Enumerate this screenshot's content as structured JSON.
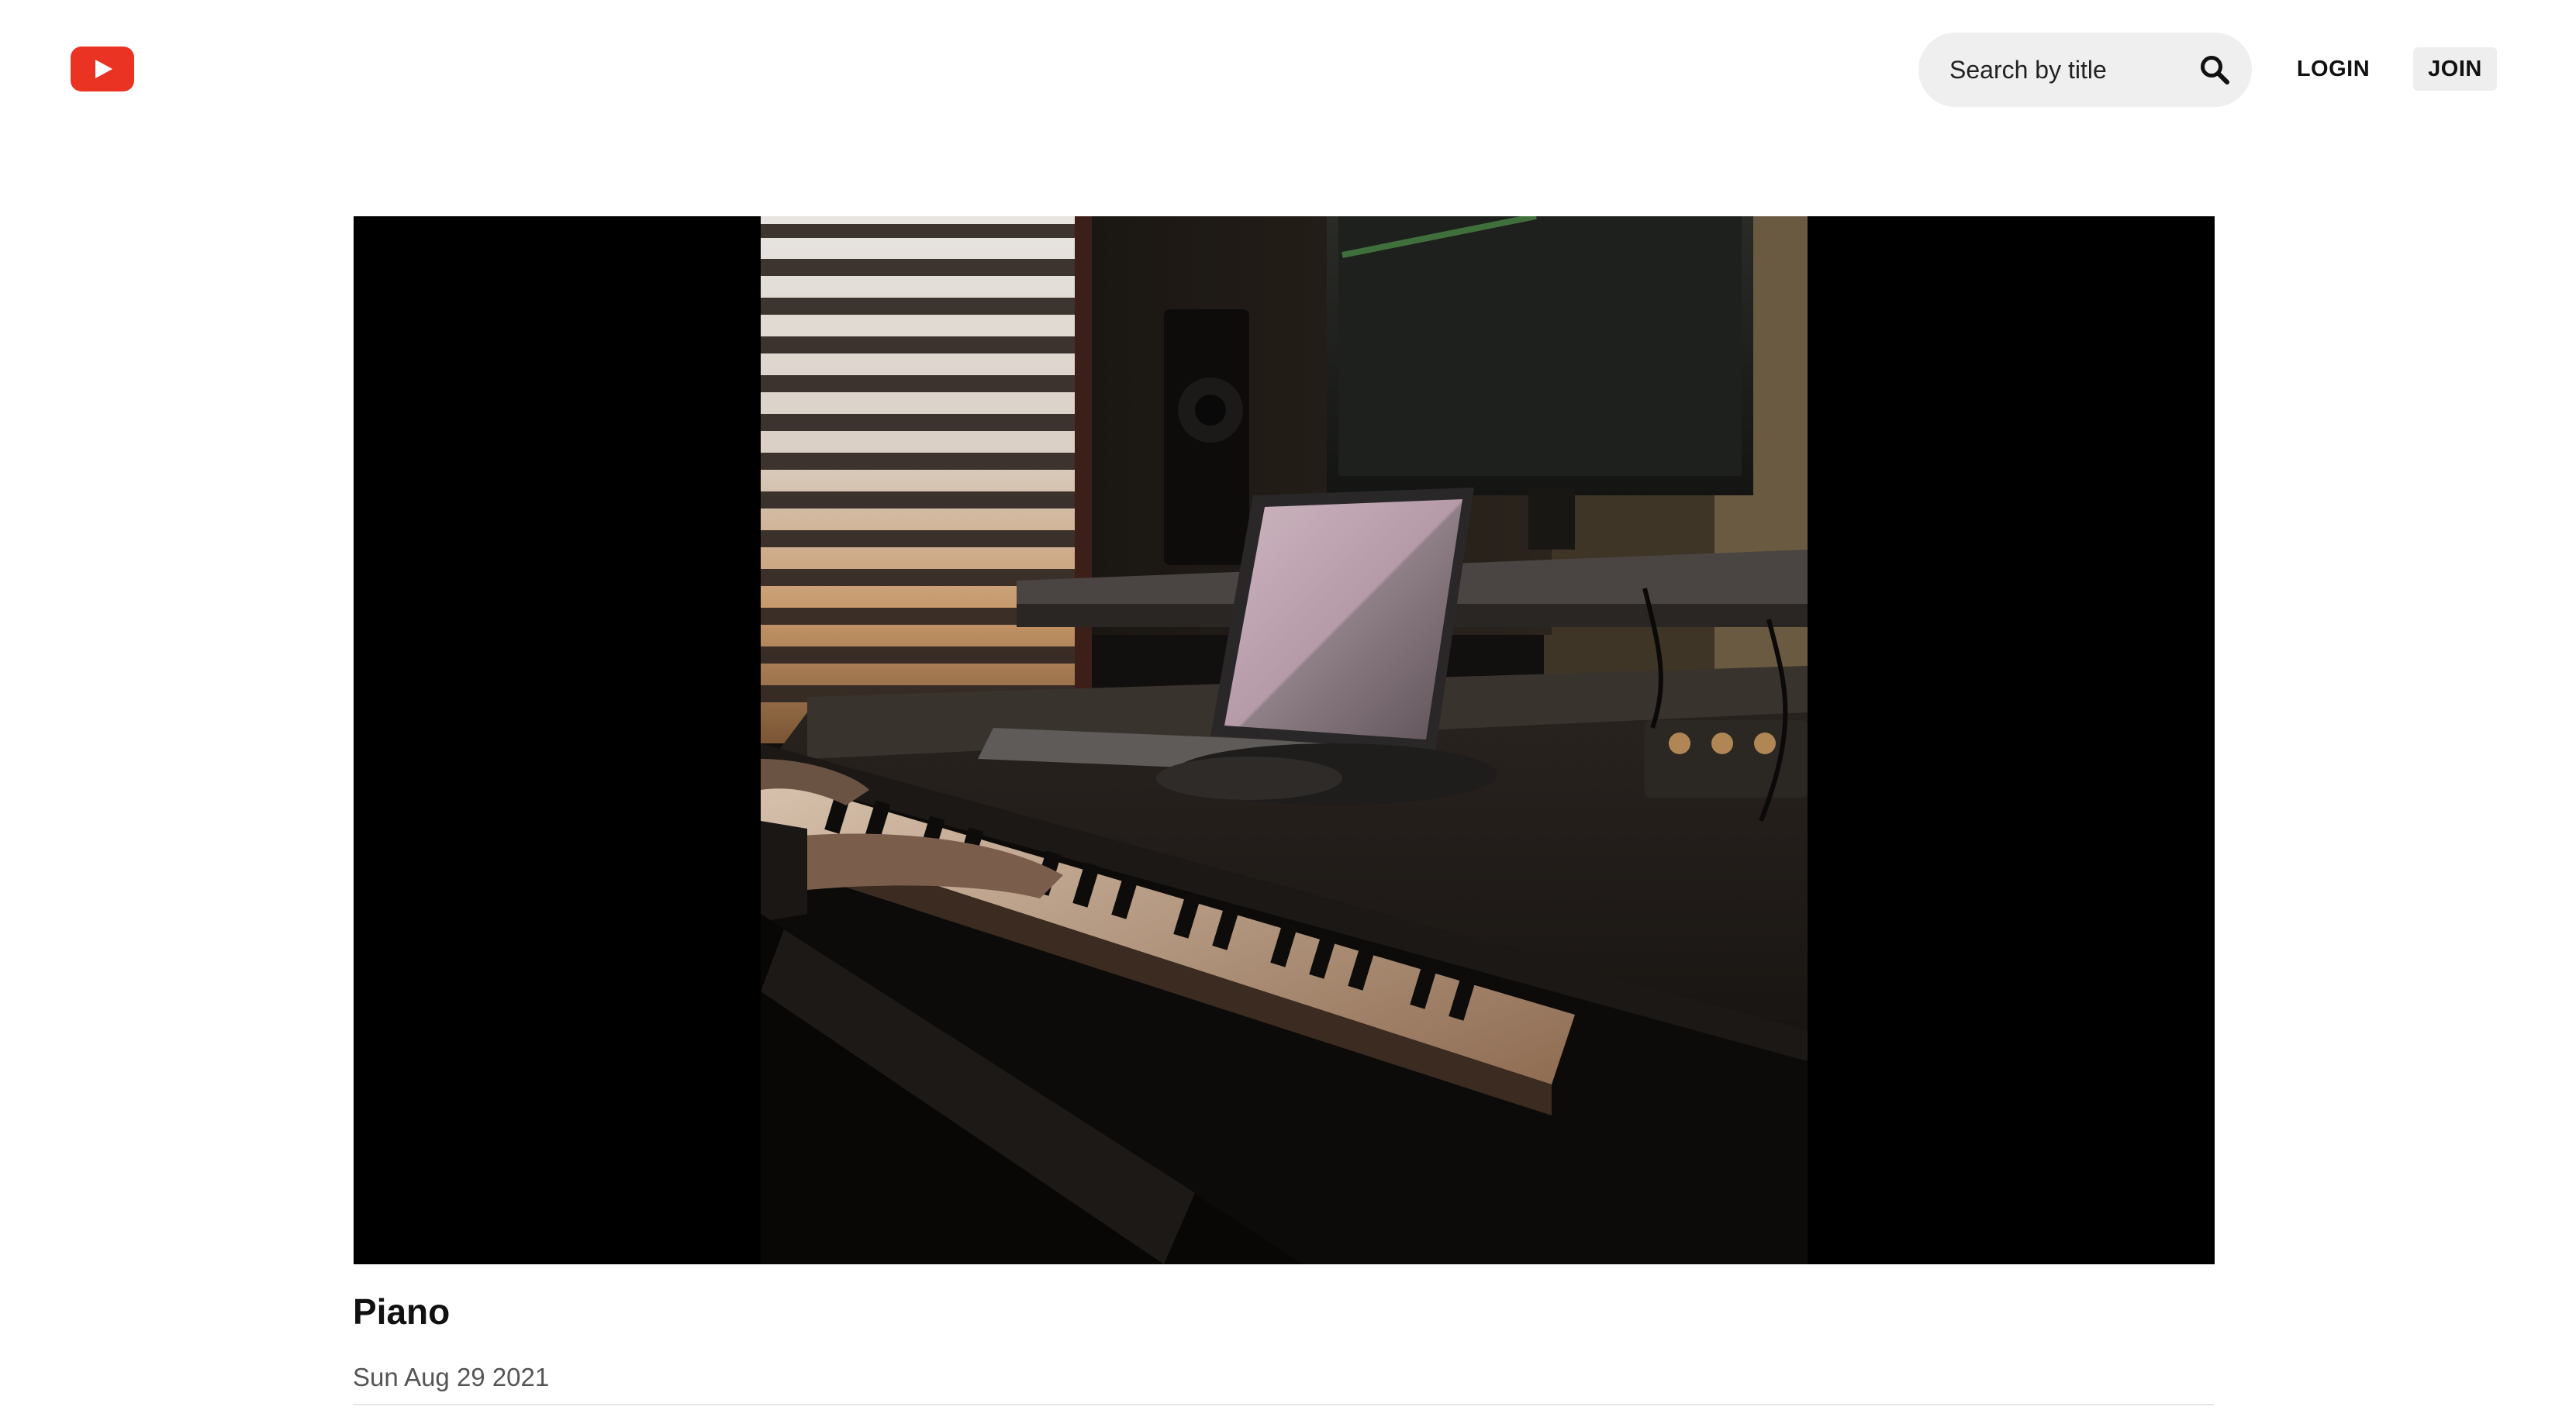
{
  "header": {
    "logo_icon": "youtube-play-icon",
    "brand_color": "#ea3323",
    "search": {
      "placeholder": "Search by title",
      "value": "",
      "icon": "search-icon"
    },
    "login_label": "LOGIN",
    "join_label": "JOIN"
  },
  "video": {
    "title": "Piano",
    "date": "Sun Aug 29 2021"
  }
}
